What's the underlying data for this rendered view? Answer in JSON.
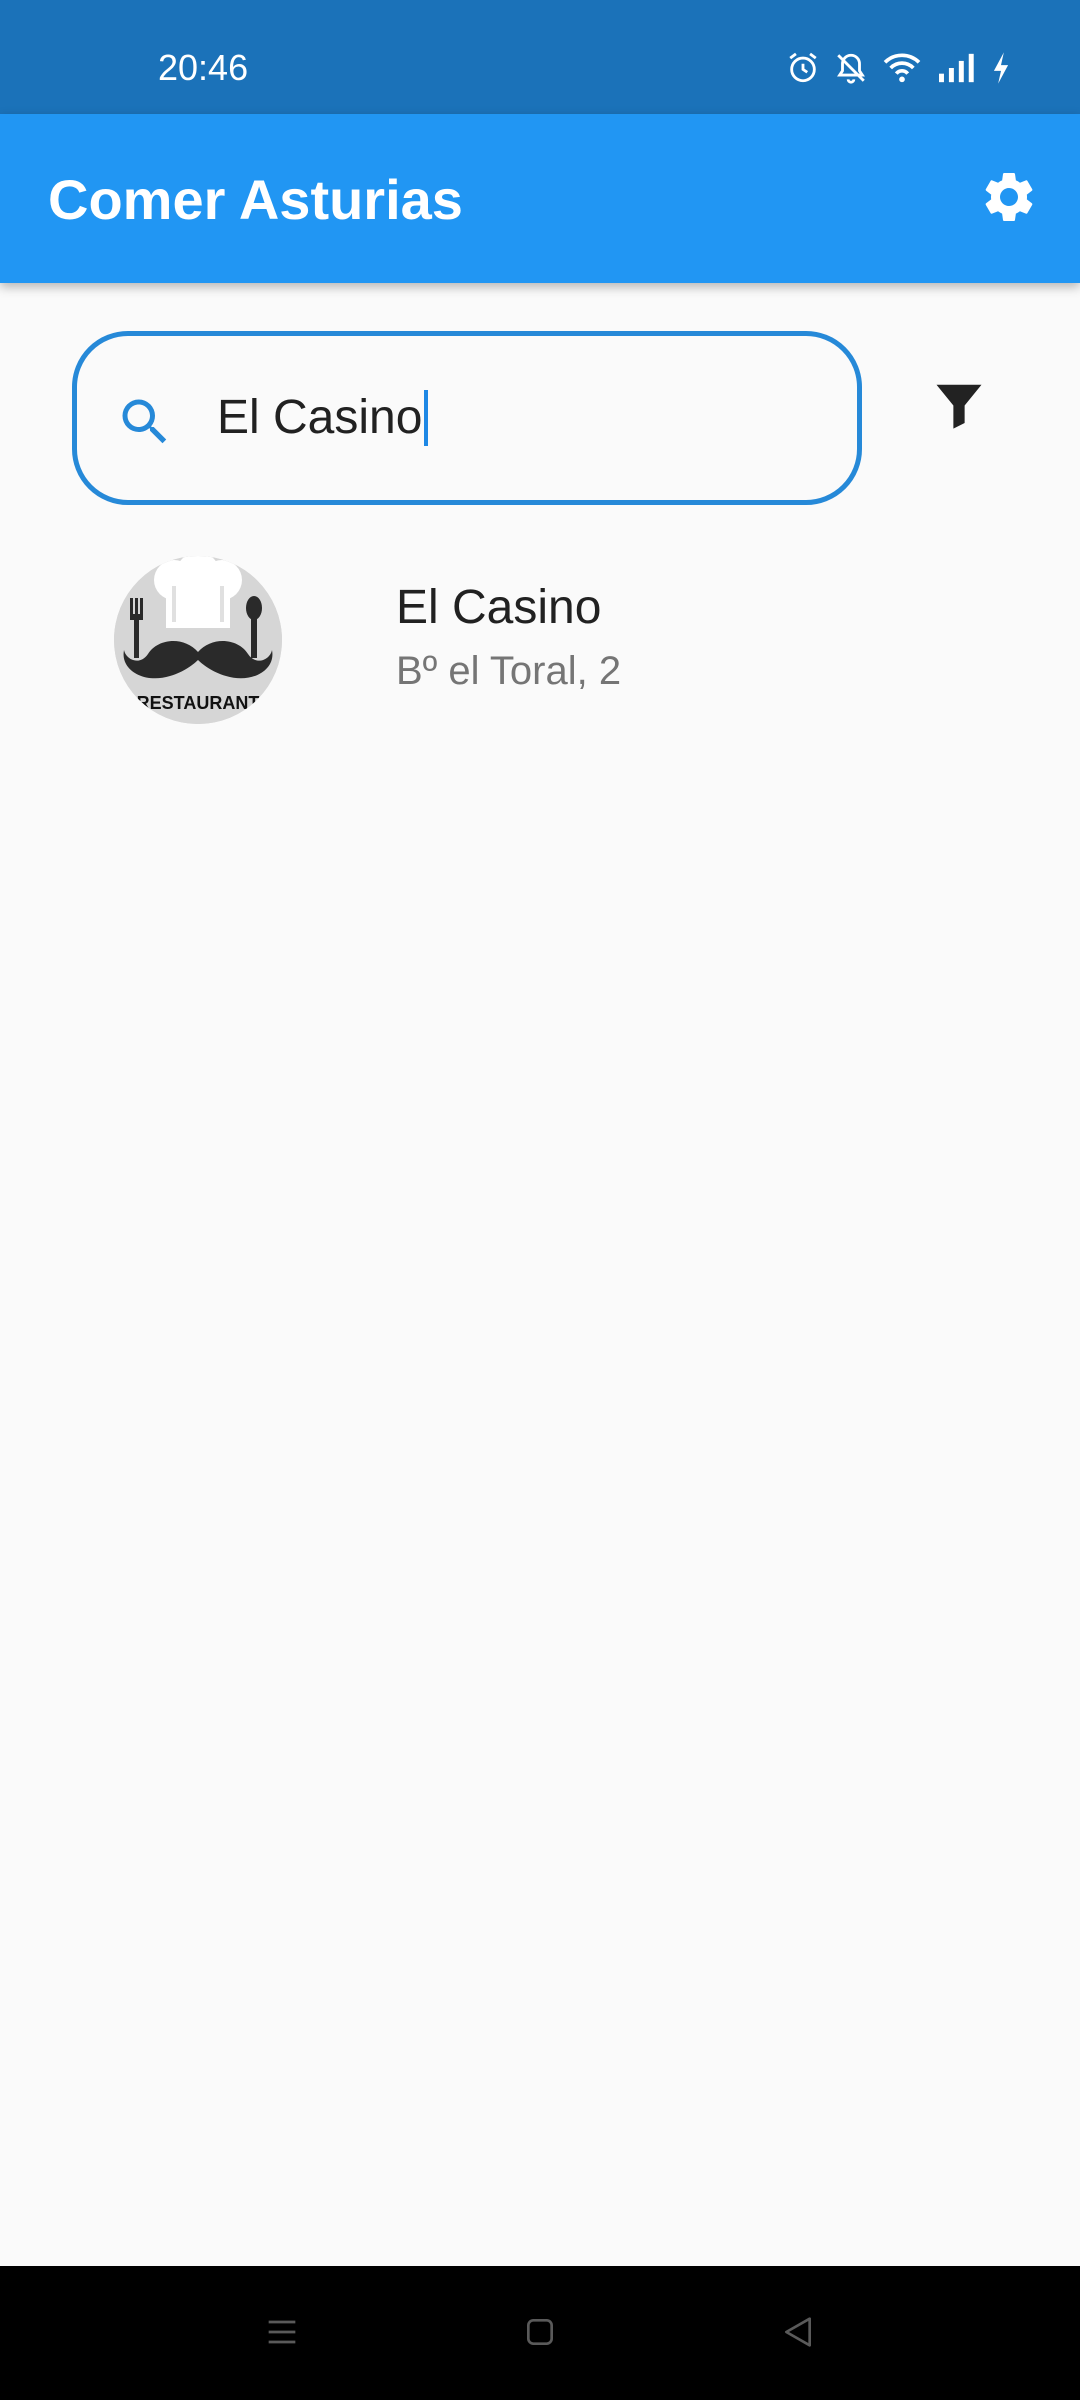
{
  "status_bar": {
    "time": "20:46",
    "icons": [
      "alarm-icon",
      "bell-off-icon",
      "wifi-icon",
      "signal-icon",
      "charging-icon"
    ]
  },
  "app_bar": {
    "title": "Comer Asturias",
    "action_icon": "gear-icon"
  },
  "search": {
    "value": "El Casino",
    "icon": "search-icon"
  },
  "filter": {
    "icon": "filter-icon"
  },
  "results": [
    {
      "name": "El Casino",
      "address": "Bº el Toral, 2",
      "avatar_text": "RESTAURANT"
    }
  ],
  "nav_bar": {
    "icons": [
      "menu-icon",
      "home-icon",
      "back-icon"
    ]
  },
  "colors": {
    "status_bar": "#1b72b9",
    "app_bar": "#2196f3",
    "search_border": "#2689d8",
    "background": "#fafafa"
  }
}
